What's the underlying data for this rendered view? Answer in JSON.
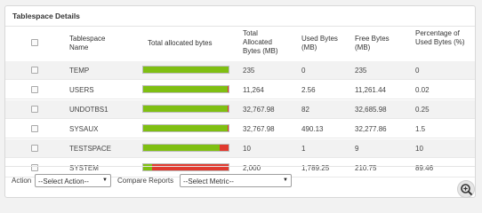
{
  "panel": {
    "title": "Tablespace Details"
  },
  "table": {
    "headers": {
      "name": [
        "Tablespace",
        "Name"
      ],
      "allocated": "Total allocated bytes",
      "total": [
        "Total",
        "Allocated",
        "Bytes (MB)"
      ],
      "used": [
        "Used Bytes",
        "(MB)"
      ],
      "free": [
        "Free Bytes",
        "(MB)"
      ],
      "pct": [
        "Percentage of",
        "Used Bytes (%)"
      ]
    },
    "colors": {
      "used": "#e03a2f",
      "free": "#7fbf12"
    },
    "rows": [
      {
        "name": "TEMP",
        "total": "235",
        "used": "0",
        "free": "235",
        "pct": "0",
        "used_fraction": 0.0
      },
      {
        "name": "USERS",
        "total": "11,264",
        "used": "2.56",
        "free": "11,261.44",
        "pct": "0.02",
        "used_fraction": 0.0002
      },
      {
        "name": "UNDOTBS1",
        "total": "32,767.98",
        "used": "82",
        "free": "32,685.98",
        "pct": "0.25",
        "used_fraction": 0.0025
      },
      {
        "name": "SYSAUX",
        "total": "32,767.98",
        "used": "490.13",
        "free": "32,277.86",
        "pct": "1.5",
        "used_fraction": 0.015
      },
      {
        "name": "TESTSPACE",
        "total": "10",
        "used": "1",
        "free": "9",
        "pct": "10",
        "used_fraction": 0.1
      },
      {
        "name": "SYSTEM",
        "total": "2,000",
        "used": "1,789.25",
        "free": "210.75",
        "pct": "89.46",
        "used_fraction": 0.8946
      }
    ]
  },
  "footer": {
    "action_label": "Action",
    "action_select": "--Select Action--",
    "compare_label": "Compare Reports",
    "metric_select": "--Select Metric--"
  },
  "icons": {
    "zoom": "zoom-in-icon"
  }
}
